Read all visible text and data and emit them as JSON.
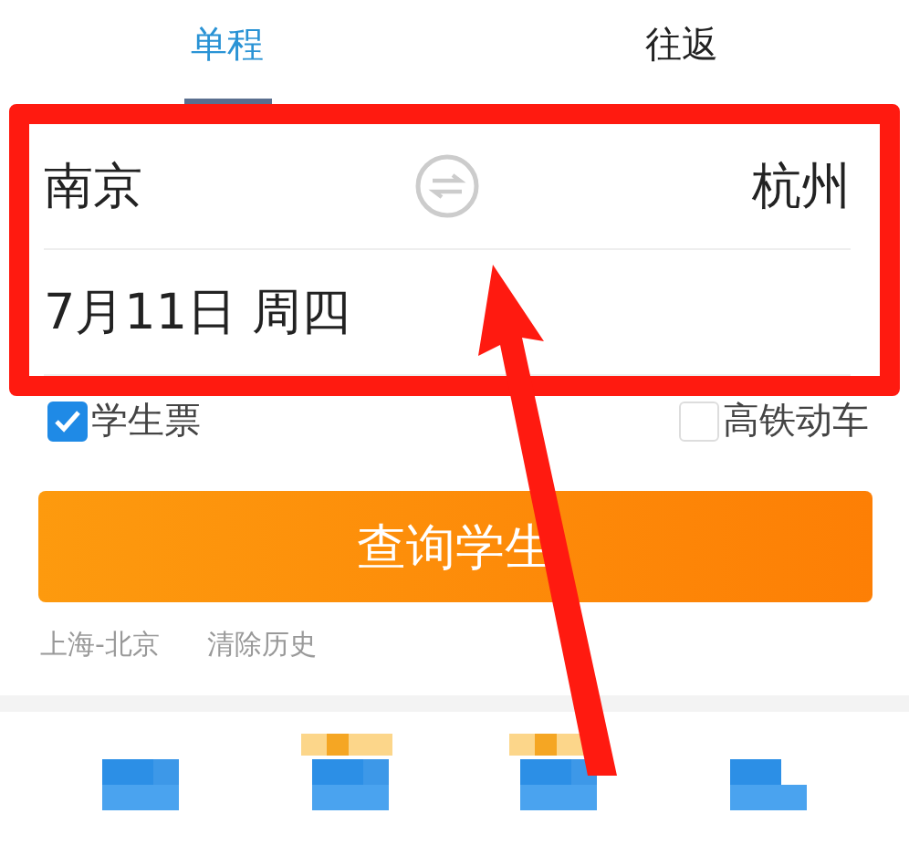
{
  "tabs": [
    {
      "label": "单程",
      "selected": true
    },
    {
      "label": "往返",
      "selected": false
    }
  ],
  "route": {
    "from": "南京",
    "to": "杭州",
    "date": "7月11日 周四"
  },
  "options": [
    {
      "label": "学生票",
      "checked": true
    },
    {
      "label": "高铁动车",
      "checked": false
    }
  ],
  "search_button": "查询学生",
  "history": [
    "上海-北京",
    "清除历史"
  ]
}
